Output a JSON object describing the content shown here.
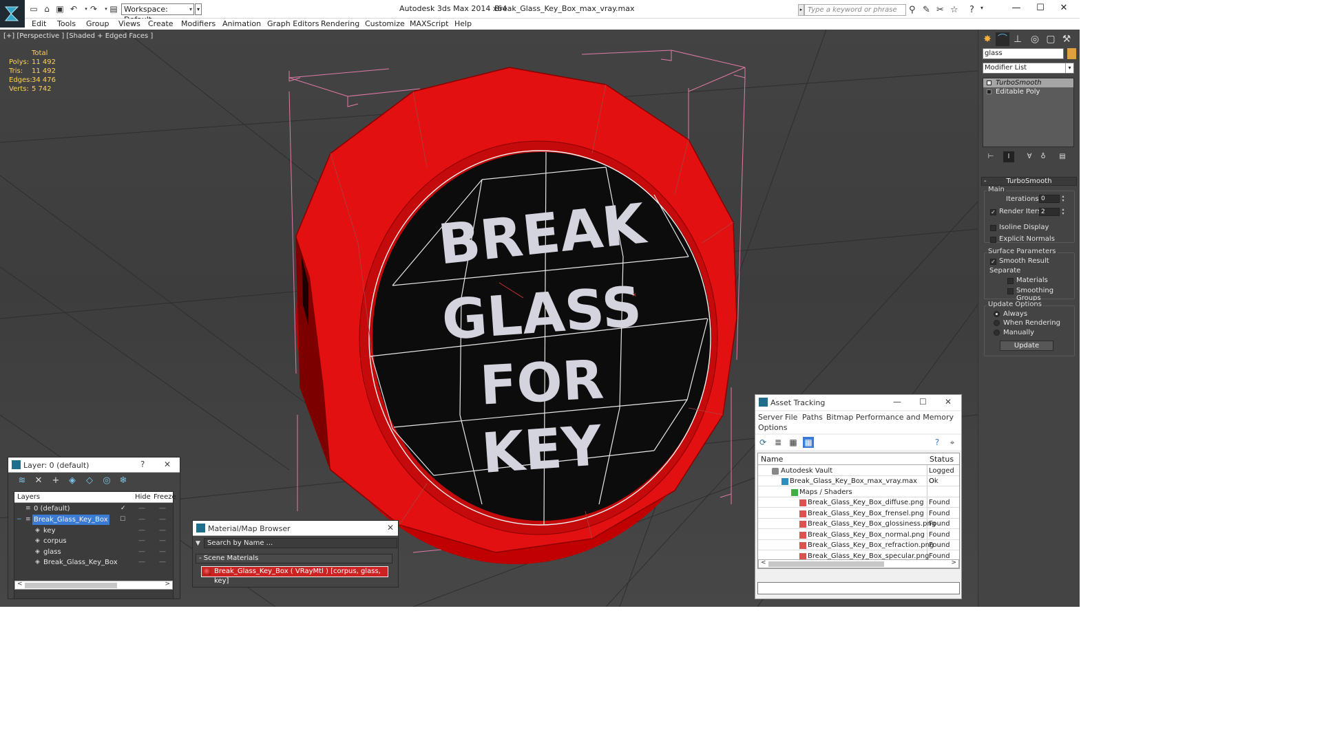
{
  "window": {
    "app_title": "Autodesk 3ds Max  2014 x64",
    "file_title": "Break_Glass_Key_Box_max_vray.max",
    "workspace": "Workspace: Default",
    "search_placeholder": "Type a keyword or phrase",
    "minimize": "—",
    "maximize": "☐",
    "close": "✕"
  },
  "menu": [
    "Edit",
    "Tools",
    "Group",
    "Views",
    "Create",
    "Modifiers",
    "Animation",
    "Graph Editors",
    "Rendering",
    "Customize",
    "MAXScript",
    "Help"
  ],
  "viewport": {
    "label": "[+] [Perspective ] [Shaded + Edged Faces ]",
    "stats_header": "Total",
    "stats": [
      {
        "label": "Polys:",
        "value": "11 492"
      },
      {
        "label": "Tris:",
        "value": "11 492"
      },
      {
        "label": "Edges:",
        "value": "34 476"
      },
      {
        "label": "Verts:",
        "value": "5 742"
      }
    ],
    "sign_text": [
      "BREAK",
      "GLASS",
      "FOR",
      "KEY"
    ]
  },
  "command_panel": {
    "object_name": "glass",
    "modifier_list": "Modifier List",
    "stack": [
      {
        "label": "TurboSmooth",
        "selected": true
      },
      {
        "label": "Editable Poly",
        "selected": false
      }
    ],
    "rollout_title": "TurboSmooth",
    "main_group": "Main",
    "iterations_label": "Iterations:",
    "iterations_value": "0",
    "render_iters_label": "Render Iters:",
    "render_iters_value": "2",
    "isoline_label": "Isoline Display",
    "explicit_normals_label": "Explicit Normals",
    "surface_group": "Surface Parameters",
    "smooth_result_label": "Smooth Result",
    "separate_label": "Separate",
    "materials_label": "Materials",
    "smoothing_groups_label": "Smoothing Groups",
    "update_group": "Update Options",
    "always_label": "Always",
    "when_rendering_label": "When Rendering",
    "manually_label": "Manually",
    "update_button": "Update"
  },
  "layer_window": {
    "title": "Layer: 0 (default)",
    "help": "?",
    "close": "✕",
    "col_layers": "Layers",
    "col_hide": "Hide",
    "col_freeze": "Freeze",
    "rows": [
      {
        "name": "0 (default)",
        "indent": 0,
        "selected": false
      },
      {
        "name": "Break_Glass_Key_Box",
        "indent": 0,
        "selected": true
      },
      {
        "name": "key",
        "indent": 1,
        "selected": false
      },
      {
        "name": "corpus",
        "indent": 1,
        "selected": false
      },
      {
        "name": "glass",
        "indent": 1,
        "selected": false
      },
      {
        "name": "Break_Glass_Key_Box",
        "indent": 1,
        "selected": false
      }
    ]
  },
  "material_browser": {
    "title": "Material/Map Browser",
    "close": "✕",
    "search_placeholder": "Search by Name ...",
    "section": "- Scene Materials",
    "material": "Break_Glass_Key_Box ( VRayMtl ) [corpus, glass, key]"
  },
  "asset_tracking": {
    "title": "Asset Tracking",
    "menu": [
      "Server",
      "File",
      "Paths",
      "Bitmap Performance and Memory",
      "Options"
    ],
    "col_name": "Name",
    "col_status": "Status",
    "rows": [
      {
        "name": "Autodesk Vault",
        "status": "Logged O",
        "indent": 1
      },
      {
        "name": "Break_Glass_Key_Box_max_vray.max",
        "status": "Ok",
        "indent": 2
      },
      {
        "name": "Maps / Shaders",
        "status": "",
        "indent": 3
      },
      {
        "name": "Break_Glass_Key_Box_diffuse.png",
        "status": "Found",
        "indent": 4
      },
      {
        "name": "Break_Glass_Key_Box_frensel.png",
        "status": "Found",
        "indent": 4
      },
      {
        "name": "Break_Glass_Key_Box_glossiness.png",
        "status": "Found",
        "indent": 4
      },
      {
        "name": "Break_Glass_Key_Box_normal.png",
        "status": "Found",
        "indent": 4
      },
      {
        "name": "Break_Glass_Key_Box_refraction.png",
        "status": "Found",
        "indent": 4
      },
      {
        "name": "Break_Glass_Key_Box_specular.png",
        "status": "Found",
        "indent": 4
      }
    ]
  },
  "colors": {
    "viewport_bg": "#424242",
    "sign_red": "#e01010",
    "face_dark": "#151515",
    "text_gray": "#d2d2dc",
    "stats_yellow": "#ffd35a",
    "selection_blue": "#3a7bd5"
  }
}
